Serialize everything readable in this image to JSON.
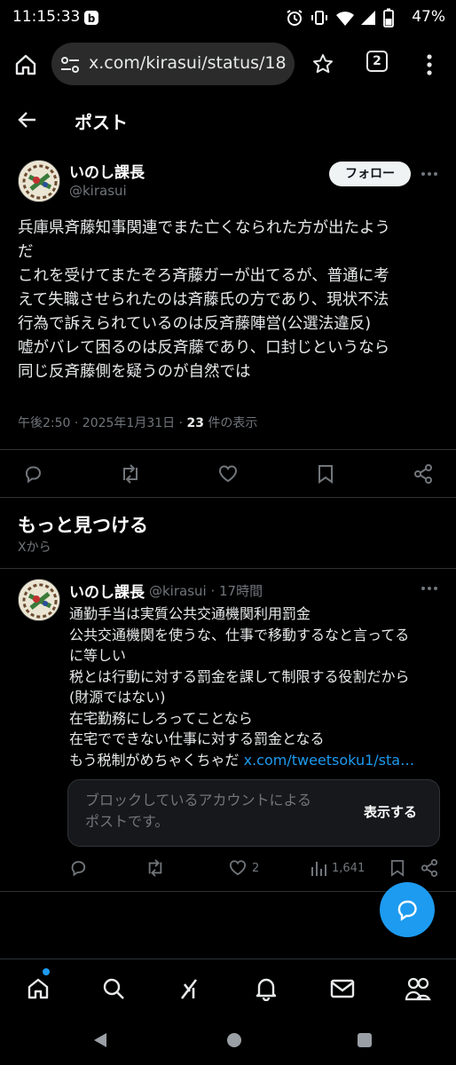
{
  "status_bar": {
    "time": "11:15:33",
    "battery": "47%"
  },
  "browser": {
    "url": "x.com/kirasui/status/188",
    "tab_count": "2"
  },
  "header": {
    "title": "ポスト"
  },
  "post": {
    "author_name": "いのし課長",
    "author_handle": "@kirasui",
    "follow_label": "フォロー",
    "text_lines": [
      "兵庫県斉藤知事関連でまた亡くなられた方が出たよう",
      "だ",
      "これを受けてまたぞろ斉藤ガーが出てるが、普通に考",
      "えて失職させられたのは斉藤氏の方であり、現状不法",
      "行為で訴えられているのは反斉藤陣営(公選法違反)",
      "嘘がバレて困るのは反斉藤であり、口封じというなら",
      "同じ反斉藤側を疑うのが自然では"
    ],
    "timestamp": "午後2:50 · 2025年1月31日 · ",
    "view_count": "23",
    "view_label": " 件の表示"
  },
  "discover": {
    "title": "もっと見つける",
    "subtitle": "Xから"
  },
  "reply": {
    "author_name": "いのし課長",
    "author_meta": "@kirasui · 17時間",
    "text_lines": [
      "通勤手当は実質公共交通機関利用罰金",
      "公共交通機関を使うな、仕事で移動するなと言ってる",
      "に等しい",
      "税とは行動に対する罰金を課して制限する役割だから",
      "(財源ではない)",
      "在宅勤務にしろってことなら",
      "在宅でできない仕事に対する罰金となる"
    ],
    "last_line_text": "もう税制がめちゃくちゃだ ",
    "last_line_link": "x.com/tweetsoku1/sta…",
    "blocked_line1": "ブロックしているアカウントによる",
    "blocked_line2": "ポストです。",
    "blocked_button": "表示する",
    "like_count": "2",
    "view_count": "1,641"
  },
  "colors": {
    "background": "#000000",
    "accent": "#1d9bf0",
    "muted": "#71767b",
    "divider": "#2f3336"
  },
  "icons": [
    "home-icon",
    "tune-icon",
    "star-icon",
    "more-vert-icon",
    "back-arrow-icon",
    "reply-icon",
    "retweet-icon",
    "like-icon",
    "bookmark-icon",
    "share-icon",
    "views-icon",
    "compose-icon",
    "search-icon",
    "grok-icon",
    "bell-icon",
    "mail-icon",
    "people-icon"
  ]
}
